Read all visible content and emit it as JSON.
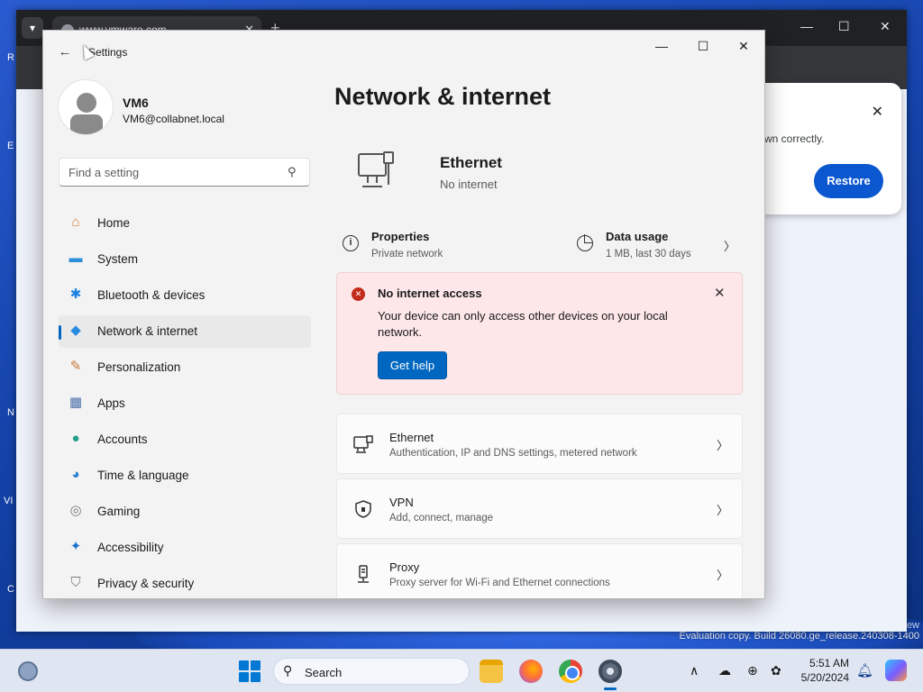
{
  "browser": {
    "tab_title": "www.vmware.com",
    "tab_close": "✕",
    "new_tab": "+",
    "restore_message": "wn correctly.",
    "restore_button": "Restore",
    "restore_close": "✕"
  },
  "desktop": {
    "letters": [
      "R",
      "E",
      "N",
      "VI",
      "C"
    ],
    "eval_text": "Evaluation copy. Build 26080.ge_release.240308-1400",
    "eval_ew": "ew"
  },
  "settings": {
    "window_title": "Settings",
    "controls": {
      "minimize": "—",
      "maximize": "☐",
      "close": "✕"
    },
    "back": "←",
    "user": {
      "name": "VM6",
      "email": "VM6@collabnet.local"
    },
    "search": {
      "placeholder": "Find a setting"
    },
    "nav": [
      {
        "label": "Home",
        "icon": "home-icon",
        "glyph": "⌂",
        "color": "#d9822b"
      },
      {
        "label": "System",
        "icon": "system-icon",
        "glyph": "▬",
        "color": "#2b8fd9"
      },
      {
        "label": "Bluetooth & devices",
        "icon": "bluetooth-icon",
        "glyph": "✱",
        "color": "#1a7fe0"
      },
      {
        "label": "Network & internet",
        "icon": "wifi-icon",
        "glyph": "◆",
        "color": "#2a8ae0",
        "active": true
      },
      {
        "label": "Personalization",
        "icon": "brush-icon",
        "glyph": "✎",
        "color": "#c8793a"
      },
      {
        "label": "Apps",
        "icon": "apps-icon",
        "glyph": "▦",
        "color": "#4a6fa8"
      },
      {
        "label": "Accounts",
        "icon": "accounts-icon",
        "glyph": "●",
        "color": "#21a08a"
      },
      {
        "label": "Time & language",
        "icon": "globe-clock-icon",
        "glyph": "◕",
        "color": "#2a7fd0"
      },
      {
        "label": "Gaming",
        "icon": "gamepad-icon",
        "glyph": "◎",
        "color": "#7a7a7a"
      },
      {
        "label": "Accessibility",
        "icon": "accessibility-icon",
        "glyph": "✦",
        "color": "#1a73d0"
      },
      {
        "label": "Privacy & security",
        "icon": "shield-icon",
        "glyph": "⛉",
        "color": "#7a7a7a"
      }
    ],
    "page_title": "Network & internet",
    "hero": {
      "title": "Ethernet",
      "status": "No internet"
    },
    "properties": {
      "title": "Properties",
      "sub": "Private network"
    },
    "data_usage": {
      "title": "Data usage",
      "sub": "1 MB, last 30 days",
      "chevron": "〉"
    },
    "alert": {
      "icon": "✕",
      "title": "No internet access",
      "body": "Your device can only access other devices on your local network.",
      "button": "Get help",
      "close": "✕"
    },
    "cards": [
      {
        "title": "Ethernet",
        "sub": "Authentication, IP and DNS settings, metered network",
        "icon": "ethernet-icon",
        "chevron": "〉"
      },
      {
        "title": "VPN",
        "sub": "Add, connect, manage",
        "icon": "vpn-shield-icon",
        "chevron": "〉"
      },
      {
        "title": "Proxy",
        "sub": "Proxy server for Wi-Fi and Ethernet connections",
        "icon": "proxy-icon",
        "chevron": "〉"
      }
    ]
  },
  "taskbar": {
    "search_label": "Search",
    "time": "5:51 AM",
    "date": "5/20/2024",
    "tray": {
      "chevron": "∧",
      "cloud": "☁",
      "globe": "⊕",
      "lang": "✿"
    }
  }
}
